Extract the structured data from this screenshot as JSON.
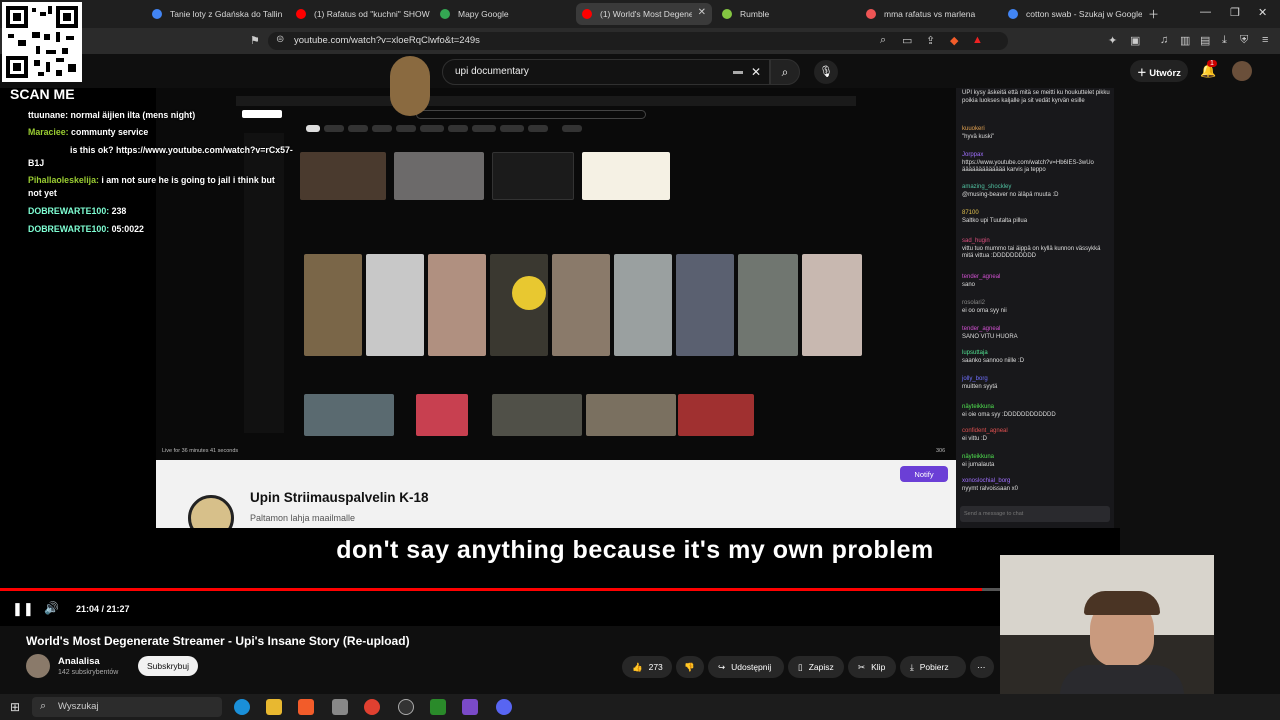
{
  "browser": {
    "tabs": [
      {
        "title": "Tanie loty z Gdańska do Tallin",
        "color": "#4285f4"
      },
      {
        "title": "(1) Rafatus od \"kuchni\" SHOW",
        "color": "#ff0000"
      },
      {
        "title": "Mapy Google",
        "color": "#34a853"
      },
      {
        "title": "(1) World's Most Degene",
        "color": "#ff0000",
        "active": true
      },
      {
        "title": "Rumble",
        "color": "#85c742"
      },
      {
        "title": "mma rafatus vs marlena",
        "color": "#e55"
      },
      {
        "title": "cotton swab - Szukaj w Google",
        "color": "#4285f4"
      }
    ],
    "url": "youtube.com/watch?v=xloeRqClwfo&t=249s"
  },
  "youtube": {
    "search_query": "upi documentary",
    "create_label": "Utwórz",
    "notification_count": "1"
  },
  "stream_overlay": {
    "scan_me": "SCAN ME",
    "chat": [
      {
        "user": "ttuunane:",
        "text": "normal äijien ilta (mens night)",
        "color": "#ffffff"
      },
      {
        "user": "Maraciee:",
        "text": "communty service",
        "color": "#9acd32"
      },
      {
        "user": "",
        "text": "is this ok? https://www.youtube.com/watch?v=rCx57-",
        "color": "#ffffff"
      },
      {
        "user": "Pihallaoleskelija:",
        "text": "i am not sure he is going to jail i think but",
        "color": "#9acd32"
      },
      {
        "user": "",
        "text": "not yet",
        "color": "#ffffff"
      },
      {
        "user": "DOBREWARTE100:",
        "text": "238",
        "color": "#7fffd4"
      },
      {
        "user": "DOBREWARTE100:",
        "text": "05:0022",
        "color": "#7fffd4"
      }
    ],
    "chat_line3_prefix": "B1J"
  },
  "inner_channel": {
    "name": "Upin Striimauspalvelin K-18",
    "subtitle": "Paltamon lahja maailmalle",
    "notify_label": "Notify",
    "live_text": "Live for 36 minutes 41 seconds",
    "viewer_count": "306"
  },
  "twitch_chat": [
    {
      "user": "",
      "text": "UPI kysy äskeitä että mitä se meitti ku houkuttelet pikku poikia luokses kaljalle ja sit vedät kyrvän esille",
      "color": "#ccc"
    },
    {
      "user": "kuuokeri",
      "text": "\"hyvä kuski\"",
      "color": "#e0a050"
    },
    {
      "user": "Jorppax",
      "text": "https://www.youtube.com/watch?v=Hb6IES-3wUo äääääääääääää karvis ja teppo",
      "color": "#a070ff"
    },
    {
      "user": "amazing_shockley",
      "text": "@musing-beaver no äläpä muuta :D",
      "color": "#50c0a0"
    },
    {
      "user": "87100",
      "text": "Saltko upi Tuutalta pillua",
      "color": "#e0c050"
    },
    {
      "user": "sad_hugin",
      "text": "vittu tuo mummo tai äippä on kyllä kunnon vässykkä mitä vittua :DDDDDDDDDD",
      "color": "#e05080"
    },
    {
      "user": "tender_agneal",
      "text": "sano",
      "color": "#d050d0"
    },
    {
      "user": "rosolari2",
      "text": "ei oo oma syy nii",
      "color": "#888"
    },
    {
      "user": "tender_agneal",
      "text": "SANO VITU HUORA",
      "color": "#d050d0"
    },
    {
      "user": "lupsuttaja",
      "text": "saanko sannoo niille :D",
      "color": "#50e090"
    },
    {
      "user": "jolly_borg",
      "text": "muitten syytä",
      "color": "#7070ff"
    },
    {
      "user": "näyteikkuna",
      "text": "ei oie oma syy :DDDDDDDDDDDD",
      "color": "#50e050"
    },
    {
      "user": "confident_agneal",
      "text": "ei vittu :D",
      "color": "#e05050"
    },
    {
      "user": "näyteikkuna",
      "text": "ei jumalauta",
      "color": "#50e050"
    },
    {
      "user": "xonoslochial_borg",
      "text": "nyymt ralvoissaan x0",
      "color": "#a070ff"
    }
  ],
  "twitch_input_placeholder": "Send a message to chat",
  "caption": "don't say anything because it's my own problem",
  "player": {
    "current_time": "21:04",
    "duration": "21:27",
    "time_display": "21:04 / 21:27",
    "progress_fraction": 0.982
  },
  "video": {
    "title": "World's Most Degenerate Streamer - Upi's Insane Story (Re-upload)",
    "channel": "Analalisa",
    "subscribers": "142 subskrybentów",
    "subscribe_label": "Subskrybuj",
    "likes": "273",
    "share_label": "Udostępnij",
    "save_label": "Zapisz",
    "clip_label": "Klip",
    "download_label": "Pobierz"
  },
  "taskbar": {
    "search_label": "Wyszukaj"
  },
  "colors": {
    "yt_red": "#ff0000",
    "twitch_purple": "#6b3fd6"
  }
}
